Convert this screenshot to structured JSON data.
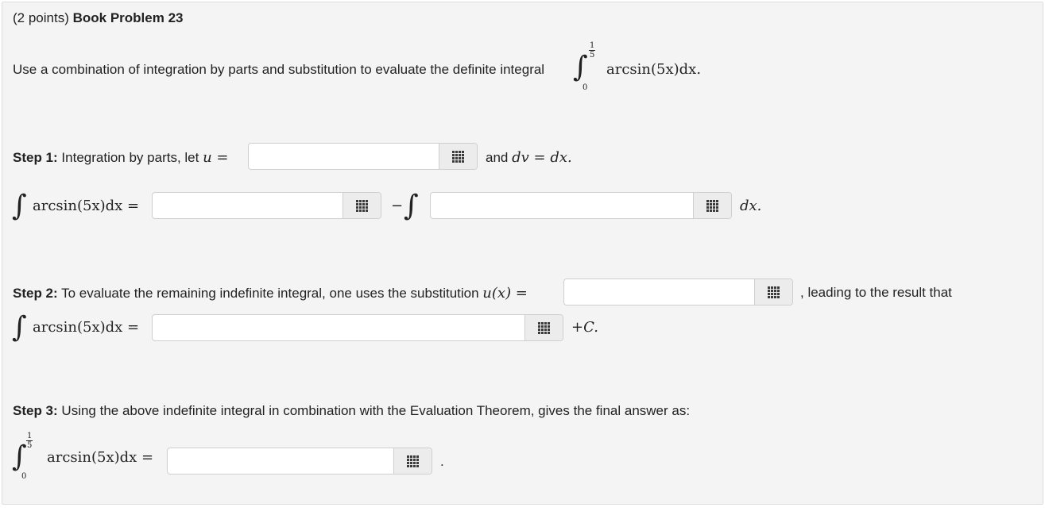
{
  "problem": {
    "points": "(2 points)",
    "title": "Book Problem 23",
    "intro_text": "Use a combination of integration by parts and substitution to evaluate the definite integral",
    "integral": {
      "upper_num": "1",
      "upper_den": "5",
      "lower": "0",
      "integrand": "arcsin(5x)dx."
    }
  },
  "step1": {
    "label": "Step 1:",
    "text": "Integration by parts, let",
    "u_eq": "u =",
    "and_text": "and",
    "dv_eq": "dv = dx.",
    "parts_lhs": "arcsin(5x)dx =",
    "minus": "−",
    "dx_tail": "dx."
  },
  "step2": {
    "label": "Step 2:",
    "text": "To evaluate the remaining indefinite integral, one uses the substitution",
    "sub_eq": "u(x) =",
    "after_text": ", leading to the result that",
    "lhs": "arcsin(5x)dx =",
    "plus_c": "+C."
  },
  "step3": {
    "label": "Step 3:",
    "text": "Using the above indefinite integral in combination with the Evaluation Theorem, gives the final answer as:",
    "upper_num": "1",
    "upper_den": "5",
    "lower": "0",
    "lhs": "arcsin(5x)dx =",
    "period": "."
  },
  "inputs": {
    "u_value": "",
    "uv_value": "",
    "vdu_value": "",
    "sub_value": "",
    "antideriv_value": "",
    "final_value": ""
  },
  "icons": {
    "palette": "equation-editor-grid-icon"
  }
}
